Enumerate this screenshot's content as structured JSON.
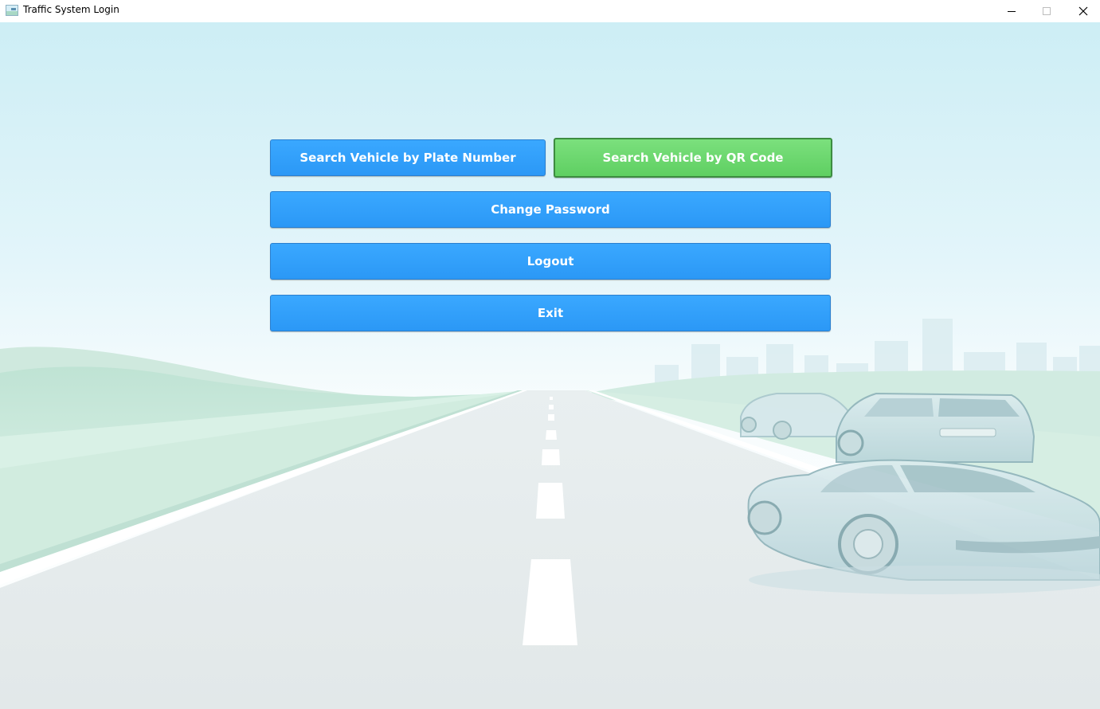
{
  "window": {
    "title": "Traffic System Login",
    "controls": {
      "minimize_icon": "minimize-icon",
      "maximize_icon": "maximize-icon",
      "close_icon": "close-icon"
    }
  },
  "menu": {
    "search_plate_label": "Search Vehicle by Plate Number",
    "search_qr_label": "Search Vehicle by QR Code",
    "change_password_label": "Change Password",
    "logout_label": "Logout",
    "exit_label": "Exit"
  },
  "colors": {
    "primary_button": "#2b9cf8",
    "highlight_button": "#6bd86e",
    "sky_top": "#cfeef5",
    "road": "#e4eaeb"
  }
}
